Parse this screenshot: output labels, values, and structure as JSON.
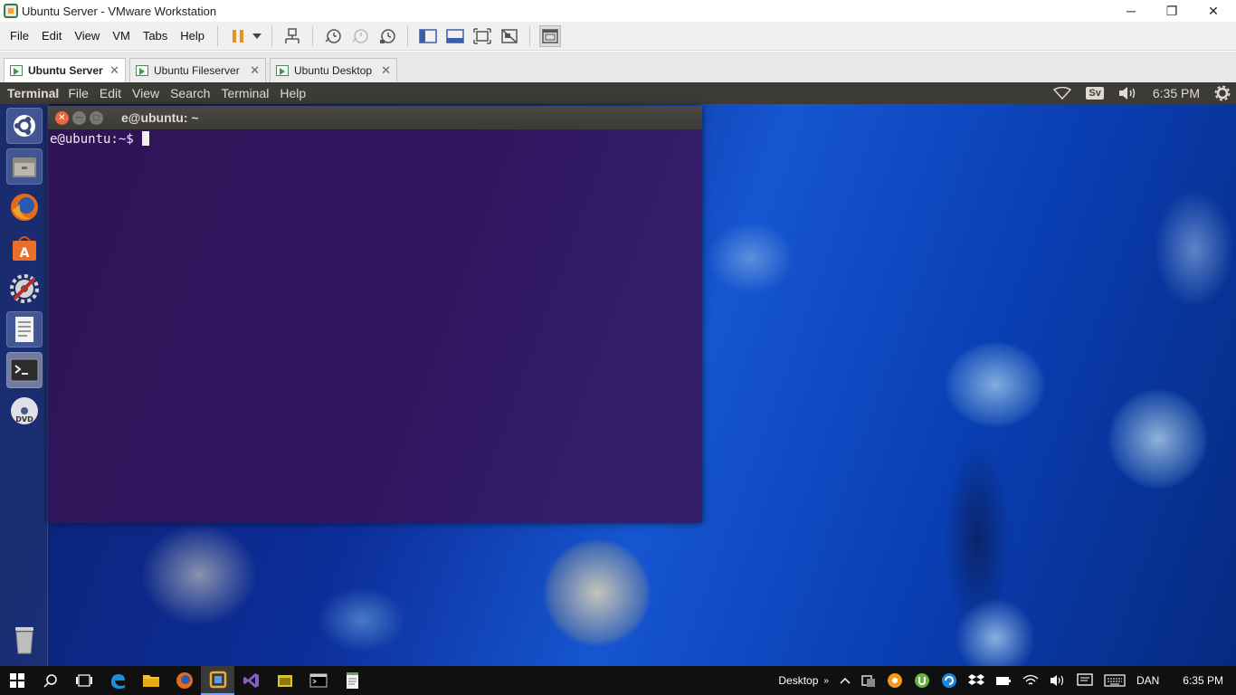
{
  "window": {
    "title": "Ubuntu Server - VMware Workstation",
    "minimize": "─",
    "restore": "❐",
    "close": "✕"
  },
  "menu": {
    "file": "File",
    "edit": "Edit",
    "view": "View",
    "vm": "VM",
    "tabs": "Tabs",
    "help": "Help"
  },
  "tabs": [
    {
      "label": "Ubuntu Server",
      "close": "✕"
    },
    {
      "label": "Ubuntu Fileserver",
      "close": "✕"
    },
    {
      "label": "Ubuntu Desktop",
      "close": "✕"
    }
  ],
  "ubuntu_panel": {
    "app_name": "Terminal",
    "menus": {
      "file": "File",
      "edit": "Edit",
      "view": "View",
      "search": "Search",
      "terminal": "Terminal",
      "help": "Help"
    },
    "keyboard_layout": "Sv",
    "clock": "6:35 PM"
  },
  "launcher": {
    "items": [
      "ubuntu-dash-icon",
      "files-icon",
      "firefox-icon",
      "software-center-icon",
      "system-settings-icon",
      "document-viewer-icon",
      "terminal-icon",
      "dvd-icon",
      "trash-icon"
    ]
  },
  "terminal": {
    "title": "e@ubuntu: ~",
    "prompt": "e@ubuntu:~$ "
  },
  "taskbar": {
    "desktop_label": "Desktop",
    "language": "DAN",
    "time": "6:35 PM"
  }
}
